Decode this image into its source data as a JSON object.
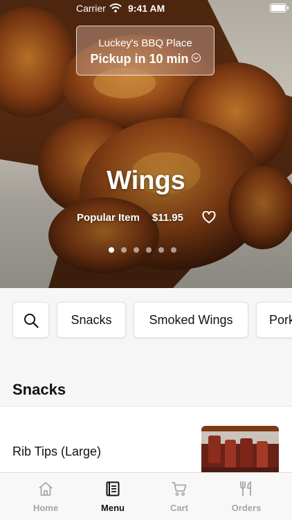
{
  "status_bar": {
    "carrier": "Carrier",
    "time": "9:41 AM"
  },
  "store": {
    "name": "Luckey's BBQ Place",
    "pickup": "Pickup in 10 min"
  },
  "hero": {
    "title": "Wings",
    "tag": "Popular Item",
    "price": "$11.95",
    "slide_count": 6,
    "active_slide": 1
  },
  "categories": {
    "items": [
      "Snacks",
      "Smoked Wings",
      "Pork"
    ]
  },
  "section": {
    "title": "Snacks"
  },
  "items": [
    {
      "name": "Rib Tips (Large)"
    }
  ],
  "tabs": [
    {
      "label": "Home",
      "icon": "home-icon",
      "active": false
    },
    {
      "label": "Menu",
      "icon": "menu-icon",
      "active": true
    },
    {
      "label": "Cart",
      "icon": "cart-icon",
      "active": false
    },
    {
      "label": "Orders",
      "icon": "utensils-icon",
      "active": false
    }
  ]
}
